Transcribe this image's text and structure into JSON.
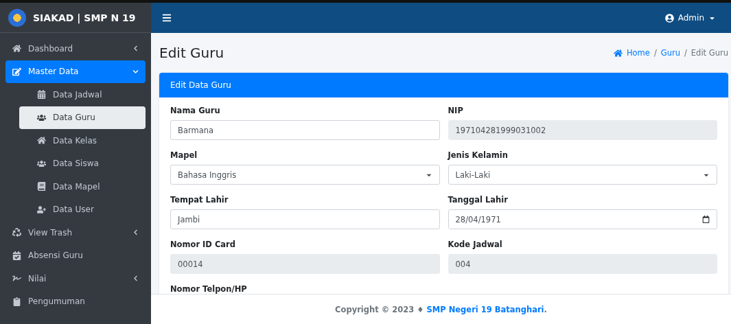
{
  "brand": {
    "title": "SIAKAD | SMP N 19"
  },
  "sidebar": {
    "items": [
      {
        "label": "Dashboard",
        "selected": false,
        "expanded": false
      },
      {
        "label": "Master Data",
        "selected": true,
        "expanded": true,
        "children": [
          {
            "label": "Data Jadwal",
            "selected": false
          },
          {
            "label": "Data Guru",
            "selected": true
          },
          {
            "label": "Data Kelas",
            "selected": false
          },
          {
            "label": "Data Siswa",
            "selected": false
          },
          {
            "label": "Data Mapel",
            "selected": false
          },
          {
            "label": "Data User",
            "selected": false
          }
        ]
      },
      {
        "label": "View Trash",
        "selected": false,
        "expanded": false
      },
      {
        "label": "Absensi Guru",
        "selected": false
      },
      {
        "label": "Nilai",
        "selected": false,
        "expanded": false
      },
      {
        "label": "Pengumuman",
        "selected": false
      }
    ]
  },
  "topbar": {
    "user": "Admin"
  },
  "page": {
    "title": "Edit Guru",
    "breadcrumb": [
      {
        "label": "Home",
        "current": false
      },
      {
        "label": "Guru",
        "current": false
      },
      {
        "label": "Edit Guru",
        "current": true
      }
    ],
    "separators": [
      "/",
      "/"
    ]
  },
  "card": {
    "title": "Edit Data Guru",
    "fields": [
      {
        "label": "Nama Guru",
        "kind": "text",
        "value": "Barmana",
        "disabled": false
      },
      {
        "label": "NIP",
        "kind": "text",
        "value": "197104281999031002",
        "disabled": true
      },
      {
        "label": "Mapel",
        "kind": "select",
        "value": "Bahasa Inggris",
        "disabled": false
      },
      {
        "label": "Jenis Kelamin",
        "kind": "select",
        "value": "Laki-Laki",
        "disabled": false
      },
      {
        "label": "Tempat Lahir",
        "kind": "text",
        "value": "Jambi",
        "disabled": false
      },
      {
        "label": "Tanggal Lahir",
        "kind": "date",
        "value": "28/04/1971",
        "disabled": false
      },
      {
        "label": "Nomor ID Card",
        "kind": "text",
        "value": "00014",
        "disabled": true
      },
      {
        "label": "Kode Jadwal",
        "kind": "text",
        "value": "004",
        "disabled": true
      },
      {
        "label": "Nomor Telpon/HP",
        "kind": "label_only"
      }
    ]
  },
  "footer": {
    "text": "Copyright © 2023 ♦",
    "link": "SMP Negeri 19 Batanghari",
    "end": "."
  }
}
